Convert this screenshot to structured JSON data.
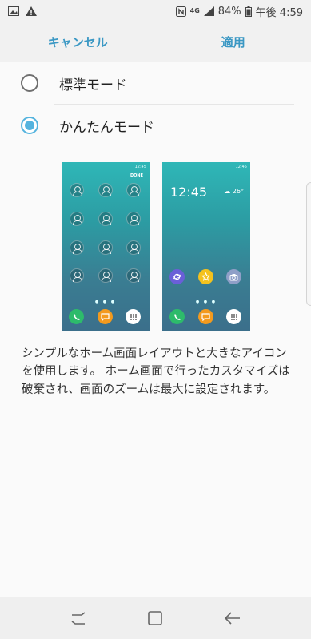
{
  "status_bar": {
    "network": "4G",
    "battery_percent": "84%",
    "time": "午後 4:59",
    "icons": [
      "image-icon",
      "alert-icon",
      "nfc-icon",
      "signal-icon",
      "battery-icon"
    ]
  },
  "action_bar": {
    "cancel_label": "キャンセル",
    "apply_label": "適用"
  },
  "options": [
    {
      "label": "標準モード",
      "selected": false
    },
    {
      "label": "かんたんモード",
      "selected": true
    }
  ],
  "preview_left": {
    "status_time": "12:45",
    "done_label": "DONE"
  },
  "preview_right": {
    "status_time": "12:45",
    "clock": "12:45",
    "temperature": "26°"
  },
  "description": "シンプルなホーム画面レイアウトと大きなアイコンを使用します。 ホーム画面で行ったカスタマイズは破棄され、画面のズームは最大に設定されます。",
  "nav_bar": {
    "icons": [
      "recent-apps-icon",
      "home-icon",
      "back-icon"
    ]
  },
  "colors": {
    "accent": "#3b98c4",
    "radio_selected": "#54b3de",
    "phone": "#2dbb6b",
    "message": "#f39a1e",
    "internet": "#6a5fd8",
    "gallery": "#f4c21d",
    "camera": "#8f9fc8"
  }
}
